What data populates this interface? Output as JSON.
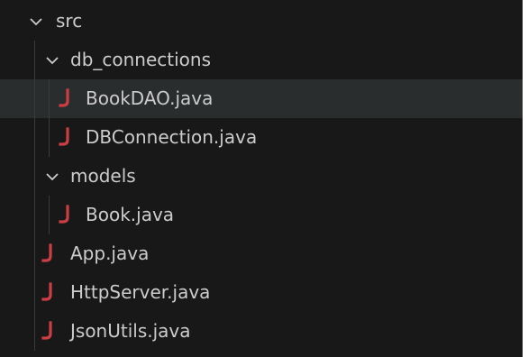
{
  "explorer": {
    "src": {
      "label": "src",
      "icon": "chevron-down-icon"
    },
    "db_connections": {
      "label": "db_connections",
      "icon": "chevron-down-icon"
    },
    "bookdao": {
      "label": "BookDAO.java",
      "icon": "java-file-icon",
      "selected": true
    },
    "dbconnection": {
      "label": "DBConnection.java",
      "icon": "java-file-icon"
    },
    "models": {
      "label": "models",
      "icon": "chevron-down-icon"
    },
    "book": {
      "label": "Book.java",
      "icon": "java-file-icon"
    },
    "app": {
      "label": "App.java",
      "icon": "java-file-icon"
    },
    "httpserver": {
      "label": "HttpServer.java",
      "icon": "java-file-icon"
    },
    "jsonutils": {
      "label": "JsonUtils.java",
      "icon": "java-file-icon"
    }
  },
  "colors": {
    "background": "#181818",
    "selected_row": "#2a2d2e",
    "text": "#cccccc",
    "java_icon": "#cc3e44",
    "indent_guide": "#3b3b3b"
  }
}
